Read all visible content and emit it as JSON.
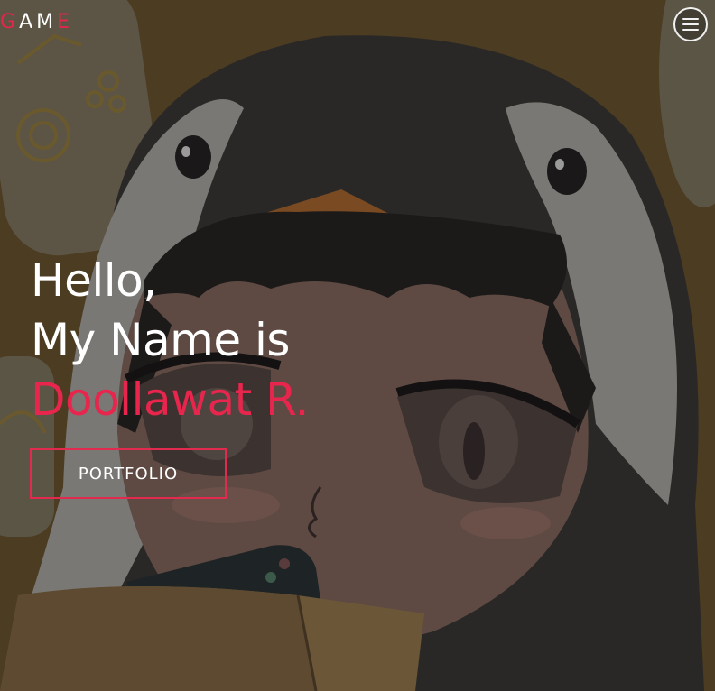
{
  "header": {
    "logo": {
      "parts": [
        "G",
        "A",
        "M",
        "E"
      ],
      "accent_color": "#e5254a"
    },
    "menu_button": {
      "icon": "hamburger-menu-icon"
    }
  },
  "hero": {
    "greeting_line1": "Hello,",
    "greeting_line2": "My Name is",
    "name": "Doollawat R.",
    "cta_label": "PORTFOLIO",
    "background_image": "chibi-penguin-hood-gamer-illustration",
    "accent_color": "#e8264d"
  }
}
